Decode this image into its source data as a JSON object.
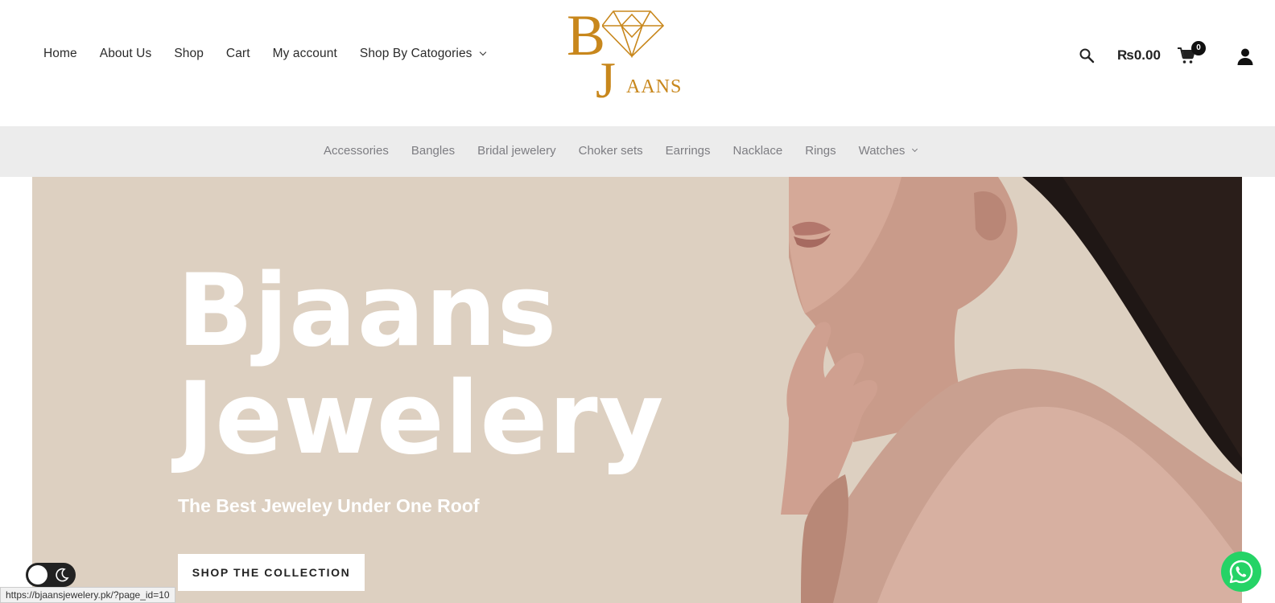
{
  "header": {
    "nav": [
      {
        "label": "Home"
      },
      {
        "label": "About Us"
      },
      {
        "label": "Shop"
      },
      {
        "label": "Cart"
      },
      {
        "label": "My account"
      },
      {
        "label": "Shop By Catogories"
      }
    ],
    "logo": {
      "letter_b": "B",
      "letter_j": "J",
      "rest": "AANS"
    },
    "cart_total": "₨0.00",
    "cart_count": "0",
    "icons": [
      "search-icon",
      "cart-icon",
      "account-icon"
    ]
  },
  "category_nav": [
    {
      "label": "Accessories"
    },
    {
      "label": "Bangles"
    },
    {
      "label": "Bridal jewelery"
    },
    {
      "label": "Choker sets"
    },
    {
      "label": "Earrings"
    },
    {
      "label": "Nacklace"
    },
    {
      "label": "Rings"
    },
    {
      "label": "Watches"
    }
  ],
  "hero": {
    "title_line1": "Bjaans",
    "title_line2": "Jewelery",
    "subtitle": "The Best Jeweley Under One Roof",
    "button_label": "SHOP THE COLLECTION"
  },
  "status_bar": {
    "url": "https://bjaansjewelery.pk/?page_id=10"
  },
  "colors": {
    "brand_gold": "#c8871c",
    "hero_bg": "#ddd0c1",
    "category_bar_bg": "#ececec",
    "whatsapp_green": "#25d366"
  }
}
